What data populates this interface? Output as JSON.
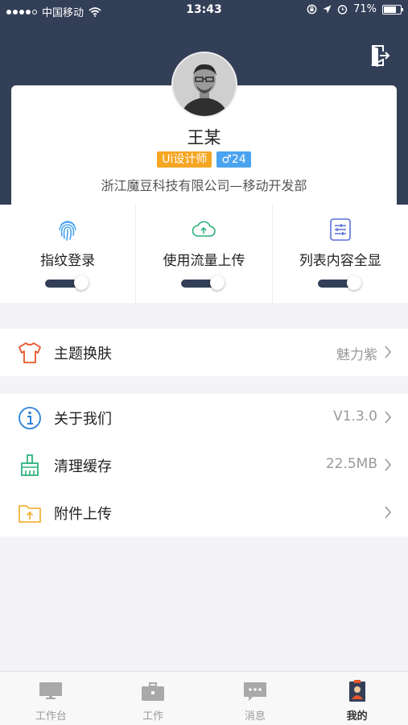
{
  "status_bar": {
    "carrier": "中国移动",
    "time": "13:43",
    "battery": "71%"
  },
  "profile": {
    "name": "王某",
    "job_tag": "Ui设计师",
    "age_tag": "♂24",
    "company": "浙江魔豆科技有限公司—移动开发部"
  },
  "toggles": [
    {
      "label": "指纹登录",
      "icon": "fingerprint-icon",
      "enabled": true
    },
    {
      "label": "使用流量上传",
      "icon": "cloud-upload-icon",
      "enabled": true
    },
    {
      "label": "列表内容全显",
      "icon": "list-settings-icon",
      "enabled": true
    }
  ],
  "settings": {
    "theme": {
      "label": "主题换肤",
      "value": "魅力紫",
      "icon": "shirt-icon"
    },
    "about": {
      "label": "关于我们",
      "value": "V1.3.0",
      "icon": "info-icon"
    },
    "cache": {
      "label": "清理缓存",
      "value": "22.5MB",
      "icon": "brush-icon"
    },
    "upload": {
      "label": "附件上传",
      "value": "",
      "icon": "folder-upload-icon"
    }
  },
  "tabbar": [
    {
      "label": "工作台",
      "icon": "desktop-icon",
      "active": false
    },
    {
      "label": "工作",
      "icon": "briefcase-icon",
      "active": false
    },
    {
      "label": "消息",
      "icon": "message-icon",
      "active": false
    },
    {
      "label": "我的",
      "icon": "profile-icon",
      "active": true
    }
  ],
  "colors": {
    "header": "#333f57",
    "job_tag": "#f5a623",
    "age_tag": "#4aa3f0",
    "theme_icon": "#e8562a",
    "info_icon": "#2b7fd8",
    "cache_icon": "#2db27d",
    "upload_icon": "#f2b43b"
  }
}
